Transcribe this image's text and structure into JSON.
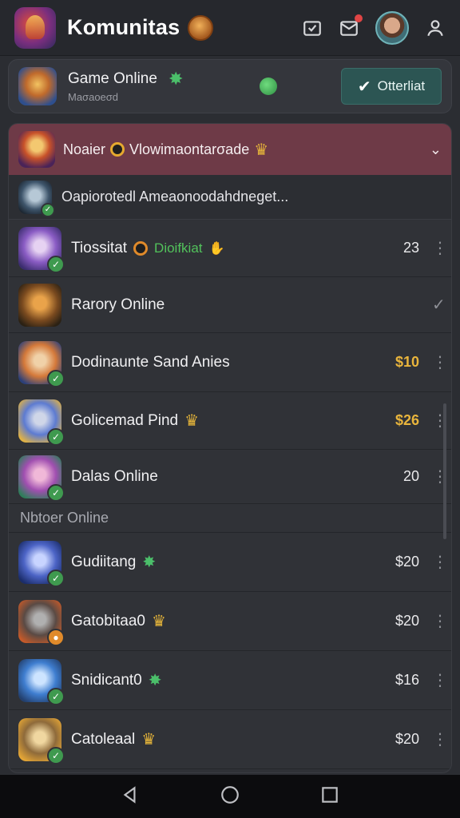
{
  "topbar": {
    "title": "Komunitas",
    "icons": [
      "app-logo-icon",
      "title-badge-icon",
      "inbox-icon",
      "notifications-icon",
      "avatar",
      "settings-icon"
    ]
  },
  "game_card": {
    "title": "Game Online",
    "subtitle": "Maσaoeσd",
    "follow_label": "Otterliat",
    "accent": "#2c5553"
  },
  "list": {
    "header": {
      "prefix": "Noaier",
      "text": "Vlowimaontarσade"
    },
    "subheader": "Oapiorotedl Ameaonoodahdneget...",
    "rows_top": [
      {
        "name": "Tiossitat",
        "note": "Dioifkiat",
        "value": "23",
        "value_style": "plain",
        "badge": "ok",
        "art": "a3",
        "more": "⋮"
      },
      {
        "name": "Rarory Online",
        "note": "",
        "value": "",
        "value_style": "check",
        "badge": "none",
        "art": "a4",
        "more": "✓"
      },
      {
        "name": "Dodinaunte Sand Anies",
        "note": "",
        "value": "$10",
        "value_style": "gold",
        "badge": "ok",
        "art": "a5",
        "more": "⋮"
      },
      {
        "name": "Golicemad Pind",
        "note": "",
        "value": "$26",
        "value_style": "gold",
        "badge": "ok",
        "art": "a6",
        "more": "⋮"
      },
      {
        "name": "Dalas Online",
        "note": "",
        "value": "20",
        "value_style": "plain",
        "badge": "ok",
        "art": "a7",
        "more": "⋮"
      }
    ],
    "section_label": "Nbtoer Online",
    "rows_bottom": [
      {
        "name": "Gudiitang",
        "value": "$20",
        "badge": "ok",
        "art": "a8",
        "more": "⋮"
      },
      {
        "name": "Gatobitaa0",
        "value": "$20",
        "badge": "orange",
        "art": "a9",
        "more": "⋮"
      },
      {
        "name": "Snidicant0",
        "value": "$16",
        "badge": "ok",
        "art": "a10",
        "more": "⋮"
      },
      {
        "name": "Catoleaal",
        "value": "$20",
        "badge": "ok",
        "art": "a11",
        "more": "⋮"
      }
    ]
  },
  "colors": {
    "background": "#2b2d32",
    "header_row": "#6e3a47",
    "gold_value": "#e9b53c",
    "verified_badge": "#3f9a4f"
  },
  "navbar": {
    "icons": [
      "back-icon",
      "home-icon",
      "recents-icon"
    ]
  }
}
